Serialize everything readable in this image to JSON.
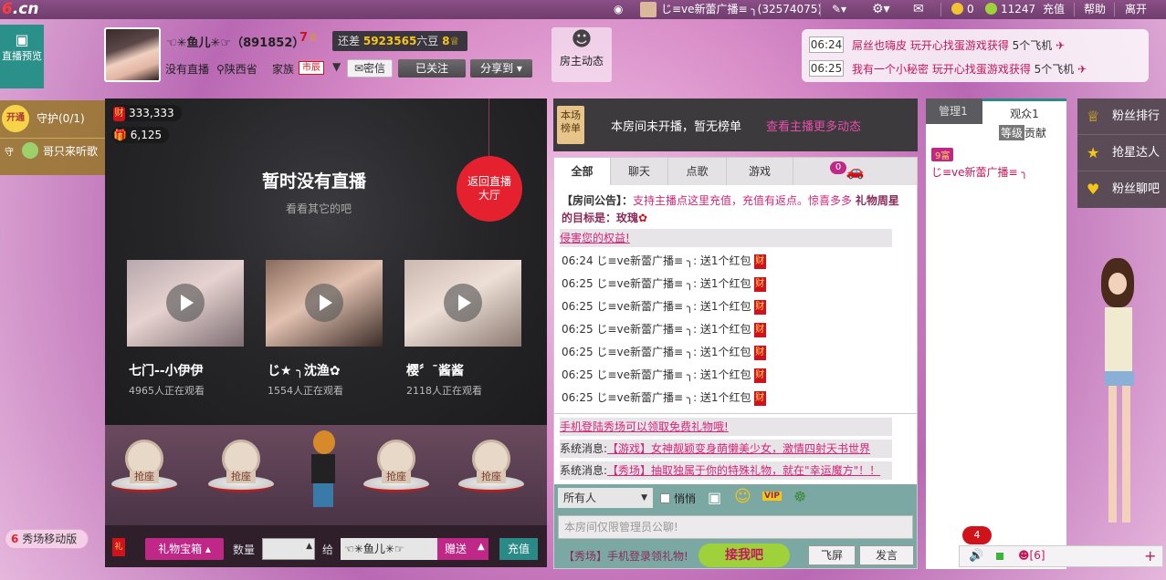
{
  "topbar": {
    "logo": "6.cn",
    "user_label": "じ≡ve新蕾广播≡ ╮(32574075)",
    "coin_count": "0",
    "bean_count": "11247",
    "recharge": "充值",
    "help": "帮助",
    "leave": "离开"
  },
  "header": {
    "live_preview": "直播预览",
    "anchor_name": "☜✳鱼儿✳☞（891852）",
    "level_badge": "7",
    "gap_label": "还差",
    "gap_value": "5923565",
    "gap_unit": "六豆",
    "next_level": "8",
    "status": "没有直播",
    "location": "陕西省",
    "family_label": "家族",
    "family_tag": "市辰",
    "private_msg": "密信",
    "followed": "已关注",
    "share": "分享到",
    "host_news": "房主动态"
  },
  "ticker": [
    {
      "time": "06:24",
      "text": "屌丝也嗨皮 玩开心找蛋游戏获得",
      "reward": "5个飞机"
    },
    {
      "time": "06:25",
      "text": "我有一个小秘密 玩开心找蛋游戏获得",
      "reward": "5个飞机"
    }
  ],
  "guard": {
    "open": "开通",
    "label": "守护(0/1)",
    "member": "哥只来听歌",
    "guard_tag": "守"
  },
  "stats": {
    "wealth": "333,333",
    "gifts": "6,125",
    "wealth_tag": "财"
  },
  "main": {
    "no_live": "暂时没有直播",
    "look_other": "看看其它的吧",
    "back_hall": "返回直播大厅",
    "anchors": [
      {
        "name": "七门--小伊伊",
        "viewers": "4965人正在观看"
      },
      {
        "name": "じ★ ╮沈渔✿",
        "viewers": "1554人正在观看"
      },
      {
        "name": "樱〞¯酱酱",
        "viewers": "2118人正在观看"
      }
    ],
    "seat_label": "抢座"
  },
  "bottombar": {
    "gift_box": "礼物宝箱",
    "quantity_label": "数量",
    "to_label": "给",
    "recipient": "☜✳鱼儿✳☞",
    "send": "赠送",
    "recharge": "充值"
  },
  "mobile_badge": "秀场移动版",
  "rank": {
    "label": "本场榜单",
    "empty": "本房间未开播，暂无榜单",
    "link": "查看主播更多动态"
  },
  "chat": {
    "tabs": [
      "全部",
      "聊天",
      "点歌",
      "游戏"
    ],
    "car_badge": "0",
    "notice_prefix": "【房间公告】：",
    "notice_body": "支持主播点这里充值，充值有返点。惊喜多多",
    "gift_week": "礼物周星的目标是：玫瑰",
    "rights": "侵害您的权益!",
    "messages": [
      {
        "time": "06:24",
        "user": "じ≡ve新蕾广播≡ ╮",
        "action": "送1个红包"
      },
      {
        "time": "06:25",
        "user": "じ≡ve新蕾广播≡ ╮",
        "action": "送1个红包"
      },
      {
        "time": "06:25",
        "user": "じ≡ve新蕾广播≡ ╮",
        "action": "送1个红包"
      },
      {
        "time": "06:25",
        "user": "じ≡ve新蕾广播≡ ╮",
        "action": "送1个红包"
      },
      {
        "time": "06:25",
        "user": "じ≡ve新蕾广播≡ ╮",
        "action": "送1个红包"
      },
      {
        "time": "06:25",
        "user": "じ≡ve新蕾广播≡ ╮",
        "action": "送1个红包"
      },
      {
        "time": "06:25",
        "user": "じ≡ve新蕾广播≡ ╮",
        "action": "送1个红包"
      }
    ],
    "sys1": "手机登陆秀场可以领取免费礼物哦!",
    "sys2_prefix": "系统消息:",
    "sys2": "【游戏】女神靓颖变身萌懒美少女，激情四射天书世界",
    "sys3_prefix": "系统消息:",
    "sys3": "【秀场】抽取独属于你的特殊礼物，就在\"幸运魔方\"！！",
    "target": "所有人",
    "whisper": "悄悄",
    "vip": "VIP",
    "input_placeholder": "本房间仅限管理员公聊!",
    "promo": "【秀场】手机登录领礼物!",
    "promo_btn": "接我吧",
    "fly_screen": "飞屏",
    "send": "发言"
  },
  "audience": {
    "tab_admin": "管理1",
    "tab_viewers": "观众1",
    "col_level": "等级",
    "col_contrib": "贡献",
    "rich_badge": "9富",
    "viewer_name": "じ≡ve新蕾广播≡ ╮"
  },
  "side_menu": [
    "粉丝排行",
    "抢星达人",
    "粉丝聊吧"
  ],
  "footer": {
    "notify_count": "4",
    "online": "[6]"
  }
}
